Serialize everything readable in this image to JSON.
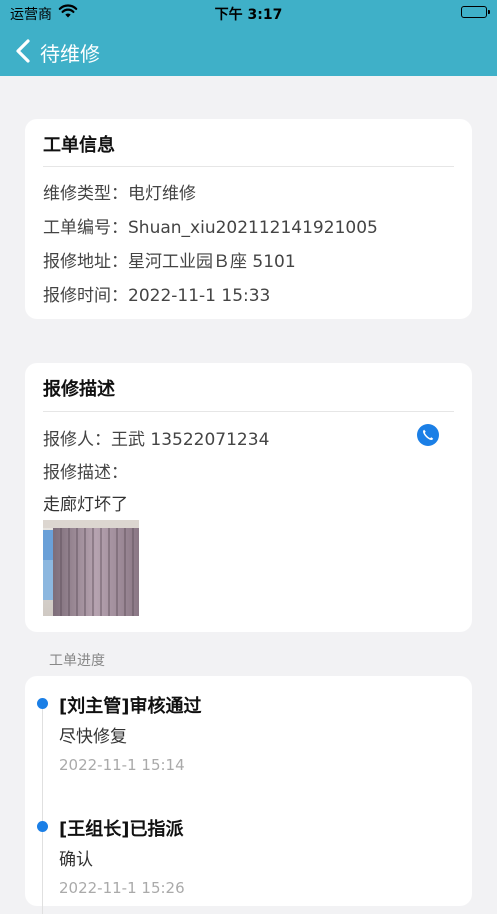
{
  "status_bar": {
    "carrier": "运营商",
    "time": "下午 3:17",
    "battery_level": 1.0
  },
  "nav": {
    "title": "待维修"
  },
  "order_info": {
    "title": "工单信息",
    "rows": [
      {
        "label": "维修类型：",
        "value": "电灯维修"
      },
      {
        "label": "工单编号：",
        "value": "Shuan_xiu202112141921005"
      },
      {
        "label": "报修地址：",
        "value": "星河工业园Ｂ座 5101"
      },
      {
        "label": "报修时间：",
        "value": "2022-11-1 15:33"
      }
    ]
  },
  "repair_desc": {
    "title": "报修描述",
    "reporter_label": "报修人：",
    "reporter_value": "王武 13522071234",
    "desc_label": "报修描述：",
    "desc_text": "走廊灯坏了"
  },
  "progress": {
    "section_label": "工单进度",
    "items": [
      {
        "title": "[刘主管]审核通过",
        "message": "尽快修复",
        "time": "2022-11-1 15:14"
      },
      {
        "title": "[王组长]已指派",
        "message": "确认",
        "time": "2022-11-1 15:26"
      }
    ]
  },
  "colors": {
    "header": "#3fb0c8",
    "accent": "#1b7fe6"
  }
}
